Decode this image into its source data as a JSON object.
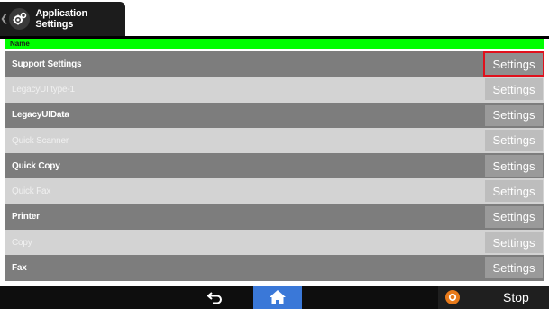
{
  "title": {
    "text": "Application Settings"
  },
  "header": {
    "column": "Name"
  },
  "rows": [
    {
      "label": "Support Settings",
      "button": "Settings",
      "style": "dark",
      "selected": true
    },
    {
      "label": "LegacyUI type-1",
      "button": "Settings",
      "style": "light"
    },
    {
      "label": "LegacyUIData",
      "button": "Settings",
      "style": "dark"
    },
    {
      "label": "Quick Scanner",
      "button": "Settings",
      "style": "light"
    },
    {
      "label": "Quick Copy",
      "button": "Settings",
      "style": "dark"
    },
    {
      "label": "Quick Fax",
      "button": "Settings",
      "style": "light"
    },
    {
      "label": "Printer",
      "button": "Settings",
      "style": "dark"
    },
    {
      "label": "Copy",
      "button": "Settings",
      "style": "light"
    },
    {
      "label": "Fax",
      "button": "Settings",
      "style": "dark"
    }
  ],
  "bottom": {
    "stop_label": "Stop"
  },
  "colors": {
    "header_green": "#00ff00",
    "selection_red": "#e0101c",
    "home_blue": "#3a78d8",
    "stop_orange": "#e87a1a"
  },
  "icons": {
    "title": "gears-icon",
    "back": "back-arrow-icon",
    "home": "home-icon",
    "stop": "stop-icon"
  }
}
